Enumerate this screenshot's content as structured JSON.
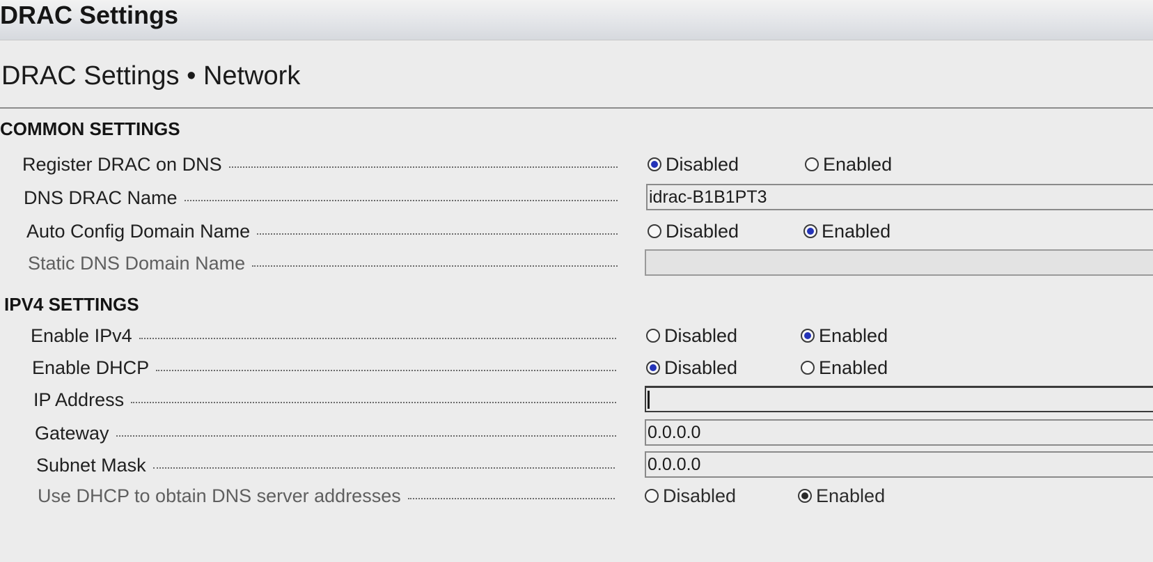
{
  "window": {
    "title": "DRAC Settings"
  },
  "page": {
    "title": "DRAC Settings • Network"
  },
  "sections": {
    "common": {
      "header": "COMMON SETTINGS",
      "register_dns": {
        "label": "Register DRAC on DNS",
        "option_disabled": "Disabled",
        "option_enabled": "Enabled",
        "selected": "Disabled"
      },
      "dns_drac_name": {
        "label": "DNS DRAC Name",
        "value": "idrac-B1B1PT3"
      },
      "auto_config_domain": {
        "label": "Auto Config Domain Name",
        "option_disabled": "Disabled",
        "option_enabled": "Enabled",
        "selected": "Enabled"
      },
      "static_dns_domain": {
        "label": "Static DNS Domain Name",
        "value": ""
      }
    },
    "ipv4": {
      "header": "IPV4 SETTINGS",
      "enable_ipv4": {
        "label": "Enable IPv4",
        "option_disabled": "Disabled",
        "option_enabled": "Enabled",
        "selected": "Enabled"
      },
      "enable_dhcp": {
        "label": "Enable DHCP",
        "option_disabled": "Disabled",
        "option_enabled": "Enabled",
        "selected": "Disabled"
      },
      "ip_address": {
        "label": "IP Address",
        "value": ""
      },
      "gateway": {
        "label": "Gateway",
        "value": "0.0.0.0"
      },
      "subnet_mask": {
        "label": "Subnet Mask",
        "value": "0.0.0.0"
      },
      "dhcp_dns": {
        "label": "Use DHCP to obtain DNS server addresses",
        "option_disabled": "Disabled",
        "option_enabled": "Enabled",
        "selected": "Enabled"
      }
    }
  },
  "colors": {
    "radio_selected": "#2433b8",
    "background": "#ececec"
  }
}
